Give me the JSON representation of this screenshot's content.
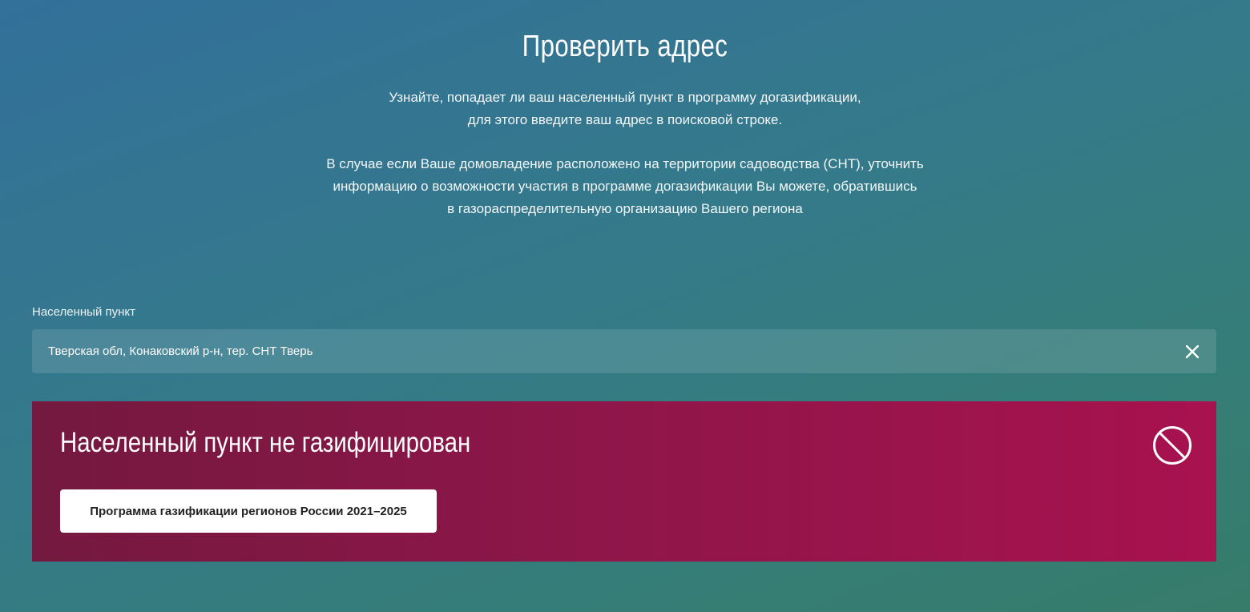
{
  "header": {
    "title": "Проверить адрес"
  },
  "intro": {
    "line1": "Узнайте, попадает ли ваш населенный пункт в программу догазификации,",
    "line2": "для этого введите ваш адрес в поисковой строке.",
    "line3": "В случае если Ваше домовладение расположено на территории садоводства (СНТ), уточнить",
    "line4": "информацию о возможности участия в программе догазификации Вы можете, обратившись",
    "line5": "в газораспределительную организацию Вашего региона"
  },
  "search": {
    "label": "Населенный пункт",
    "value": "Тверская обл, Конаковский р-н, тер. СНТ Тверь",
    "clear_icon": "close-icon"
  },
  "result": {
    "title": "Населенный пункт не газифицирован",
    "status_icon": "prohibited-icon",
    "button_label": "Программа газификации регионов России 2021–2025"
  },
  "colors": {
    "background_top": "#33709a",
    "background_bottom": "#377c6a",
    "result_left": "#74193f",
    "result_right": "#a8124f"
  }
}
